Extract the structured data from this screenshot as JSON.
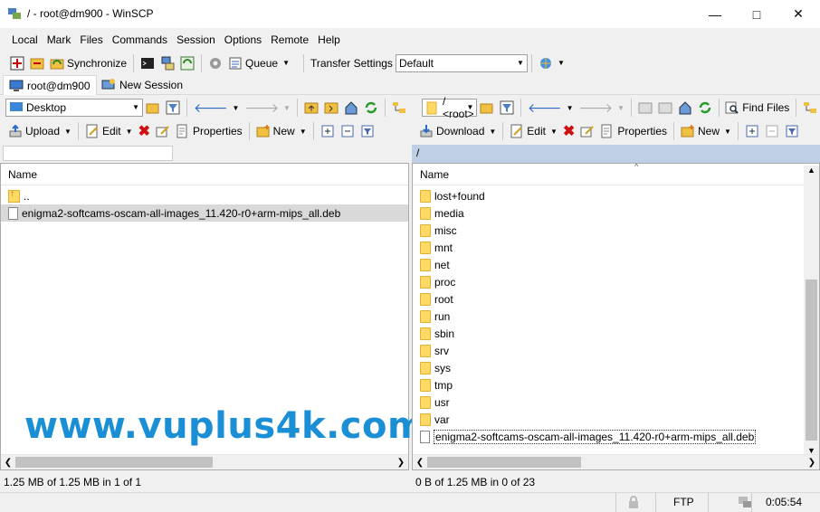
{
  "window": {
    "title": "/ - root@dm900 - WinSCP"
  },
  "menu": [
    "Local",
    "Mark",
    "Files",
    "Commands",
    "Session",
    "Options",
    "Remote",
    "Help"
  ],
  "toolbar": {
    "synchronize": "Synchronize",
    "queue": "Queue",
    "transfer_settings_label": "Transfer Settings",
    "transfer_settings_value": "Default"
  },
  "tabs": [
    {
      "label": "root@dm900"
    },
    {
      "label": "New Session"
    }
  ],
  "left": {
    "location": "Desktop",
    "actions": {
      "upload": "Upload",
      "edit": "Edit",
      "properties": "Properties",
      "new": "New"
    },
    "column_name": "Name",
    "files": [
      {
        "name": "..",
        "type": "up"
      },
      {
        "name": "enigma2-softcams-oscam-all-images_11.420-r0+arm-mips_all.deb",
        "type": "file",
        "selected": true
      }
    ],
    "status": "1.25 MB of 1.25 MB in 1 of 1"
  },
  "right": {
    "location": "/ <root>",
    "path": "/",
    "find_files": "Find Files",
    "actions": {
      "download": "Download",
      "edit": "Edit",
      "properties": "Properties",
      "new": "New"
    },
    "column_name": "Name",
    "files": [
      {
        "name": "lost+found",
        "type": "folder"
      },
      {
        "name": "media",
        "type": "folder"
      },
      {
        "name": "misc",
        "type": "folder"
      },
      {
        "name": "mnt",
        "type": "folder"
      },
      {
        "name": "net",
        "type": "folder"
      },
      {
        "name": "proc",
        "type": "folder"
      },
      {
        "name": "root",
        "type": "folder"
      },
      {
        "name": "run",
        "type": "folder"
      },
      {
        "name": "sbin",
        "type": "folder"
      },
      {
        "name": "srv",
        "type": "folder"
      },
      {
        "name": "sys",
        "type": "folder"
      },
      {
        "name": "tmp",
        "type": "folder"
      },
      {
        "name": "usr",
        "type": "folder"
      },
      {
        "name": "var",
        "type": "folder"
      },
      {
        "name": "enigma2-softcams-oscam-all-images_11.420-r0+arm-mips_all.deb",
        "type": "file",
        "focused": true
      }
    ],
    "status": "0 B of 1.25 MB in 0 of 23"
  },
  "statusbar": {
    "protocol": "FTP",
    "elapsed": "0:05:54"
  },
  "watermark": "www.vuplus4k.com",
  "colors": {
    "path_bar": "#bfcfe6",
    "watermark": "#1a8fd6",
    "selection": "#d9d9d9"
  }
}
